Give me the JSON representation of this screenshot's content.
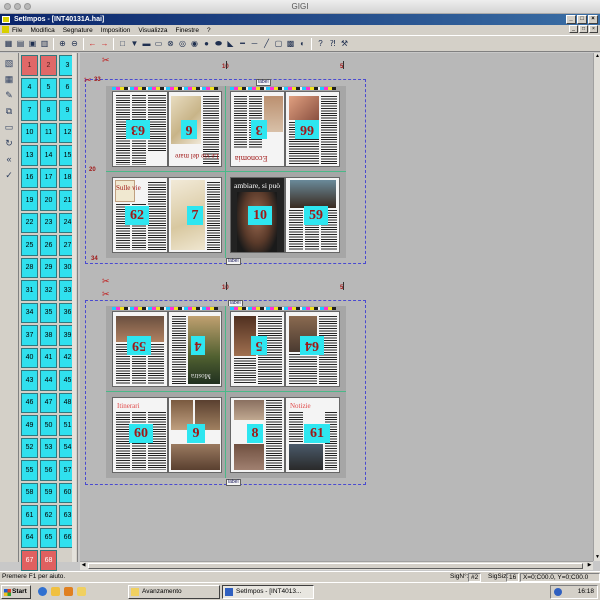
{
  "mac_title": "GIGI",
  "window": {
    "title": "SetImpos - [INT40131A.hai]"
  },
  "menu": [
    "File",
    "Modifica",
    "Segnature",
    "Imposition",
    "Visualizza",
    "Finestre",
    "?"
  ],
  "signatures": [
    {
      "n": "1",
      "state": "selected"
    },
    {
      "n": "2",
      "state": "selected"
    },
    {
      "n": "3",
      "state": "normal"
    },
    {
      "n": "4",
      "state": "normal"
    },
    {
      "n": "5",
      "state": "normal"
    },
    {
      "n": "6",
      "state": "normal"
    },
    {
      "n": "7",
      "state": "normal"
    },
    {
      "n": "8",
      "state": "normal"
    },
    {
      "n": "9",
      "state": "normal"
    },
    {
      "n": "10",
      "state": "normal"
    },
    {
      "n": "11",
      "state": "normal"
    },
    {
      "n": "12",
      "state": "normal"
    },
    {
      "n": "13",
      "state": "normal"
    },
    {
      "n": "14",
      "state": "normal"
    },
    {
      "n": "15",
      "state": "normal"
    },
    {
      "n": "16",
      "state": "normal"
    },
    {
      "n": "17",
      "state": "normal"
    },
    {
      "n": "18",
      "state": "normal"
    },
    {
      "n": "19",
      "state": "normal"
    },
    {
      "n": "20",
      "state": "normal"
    },
    {
      "n": "21",
      "state": "normal"
    },
    {
      "n": "22",
      "state": "normal"
    },
    {
      "n": "23",
      "state": "normal"
    },
    {
      "n": "24",
      "state": "normal"
    },
    {
      "n": "25",
      "state": "normal"
    },
    {
      "n": "26",
      "state": "normal"
    },
    {
      "n": "27",
      "state": "normal"
    },
    {
      "n": "28",
      "state": "normal"
    },
    {
      "n": "29",
      "state": "normal"
    },
    {
      "n": "30",
      "state": "normal"
    },
    {
      "n": "31",
      "state": "normal"
    },
    {
      "n": "32",
      "state": "normal"
    },
    {
      "n": "33",
      "state": "normal"
    },
    {
      "n": "34",
      "state": "normal"
    },
    {
      "n": "35",
      "state": "normal"
    },
    {
      "n": "36",
      "state": "normal"
    },
    {
      "n": "37",
      "state": "normal"
    },
    {
      "n": "38",
      "state": "normal"
    },
    {
      "n": "39",
      "state": "normal"
    },
    {
      "n": "40",
      "state": "normal"
    },
    {
      "n": "41",
      "state": "normal"
    },
    {
      "n": "42",
      "state": "normal"
    },
    {
      "n": "43",
      "state": "normal"
    },
    {
      "n": "44",
      "state": "normal"
    },
    {
      "n": "45",
      "state": "normal"
    },
    {
      "n": "46",
      "state": "normal"
    },
    {
      "n": "47",
      "state": "normal"
    },
    {
      "n": "48",
      "state": "normal"
    },
    {
      "n": "49",
      "state": "normal"
    },
    {
      "n": "50",
      "state": "normal"
    },
    {
      "n": "51",
      "state": "normal"
    },
    {
      "n": "52",
      "state": "normal"
    },
    {
      "n": "53",
      "state": "normal"
    },
    {
      "n": "54",
      "state": "normal"
    },
    {
      "n": "55",
      "state": "normal"
    },
    {
      "n": "56",
      "state": "normal"
    },
    {
      "n": "57",
      "state": "normal"
    },
    {
      "n": "58",
      "state": "normal"
    },
    {
      "n": "59",
      "state": "normal"
    },
    {
      "n": "60",
      "state": "normal"
    },
    {
      "n": "61",
      "state": "normal"
    },
    {
      "n": "62",
      "state": "normal"
    },
    {
      "n": "63",
      "state": "normal"
    },
    {
      "n": "64",
      "state": "normal"
    },
    {
      "n": "65",
      "state": "normal"
    },
    {
      "n": "66",
      "state": "normal"
    },
    {
      "n": "67",
      "state": "dark"
    },
    {
      "n": "68",
      "state": "dark"
    }
  ],
  "sheet1": {
    "markers": [
      "33",
      "10",
      "5",
      "20",
      "34"
    ],
    "mark_label": "label",
    "pages": [
      "63",
      "6",
      "3",
      "66",
      "62",
      "7",
      "10",
      "59"
    ],
    "headlines": [
      "Le vie del mare",
      "Economia",
      "Sulle vie",
      "ambiare, si può"
    ]
  },
  "sheet2": {
    "markers": [
      "10",
      "5"
    ],
    "mark_label": "label",
    "pages": [
      "59",
      "4",
      "5",
      "64",
      "60",
      "9",
      "8",
      "61"
    ],
    "headlines": [
      "Mostra",
      "Itinerari",
      "Notizie"
    ]
  },
  "status": {
    "help": "Premere F1 per aiuto.",
    "sig_label": "SigN°:",
    "sig_value": "#2",
    "sigsiz_label": "SigSiz:",
    "sigsiz_value": "16",
    "coords": "X=0;C00.0, Y=0;C00.0"
  },
  "taskbar": {
    "start": "Start",
    "tasks": [
      "Avanzamento",
      "SetImpos - [INT4013..."
    ],
    "clock": "16:18"
  }
}
